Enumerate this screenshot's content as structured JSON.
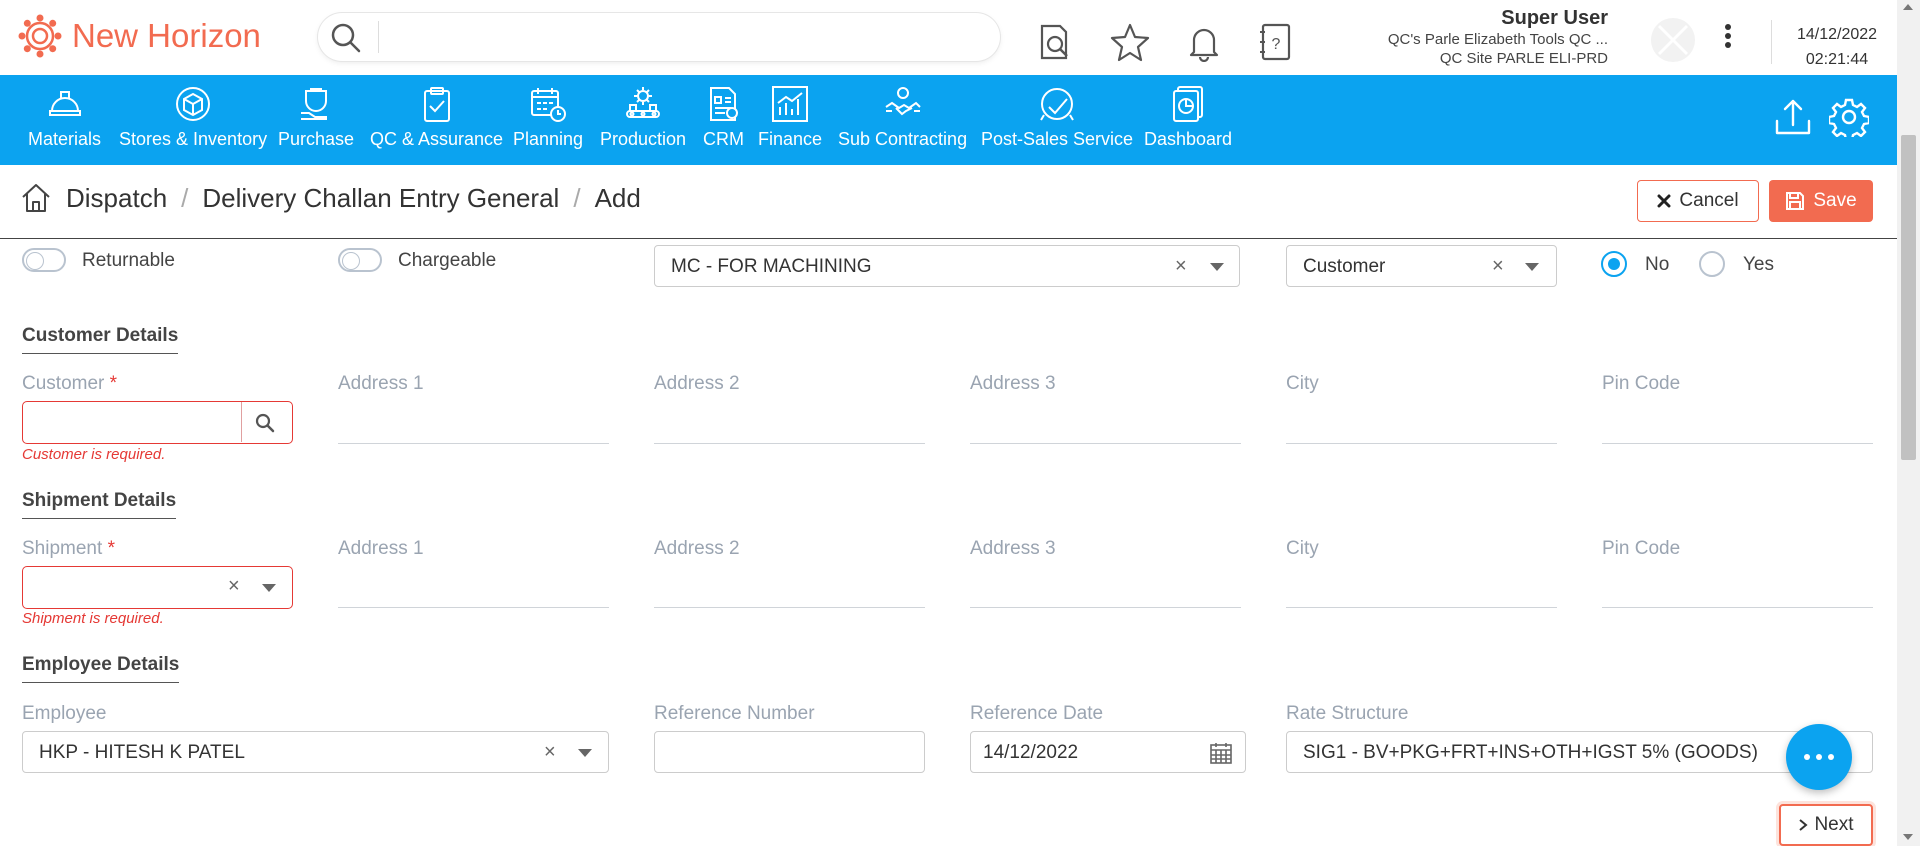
{
  "app": {
    "name": "New Horizon",
    "brand_color": "#f26b50",
    "nav_color": "#0ba3f0"
  },
  "search": {
    "placeholder": "",
    "value": ""
  },
  "topbar_icons": [
    "report-search-icon",
    "star-icon",
    "bell-icon",
    "help-book-icon"
  ],
  "user": {
    "name": "Super User",
    "company": "QC's Parle Elizabeth Tools QC ...",
    "site": "QC Site PARLE ELI-PRD"
  },
  "datetime": {
    "date": "14/12/2022",
    "time": "02:21:44"
  },
  "nav": {
    "items": [
      {
        "label": "Materials",
        "icon": "helmet-icon"
      },
      {
        "label": "Stores & Inventory",
        "icon": "box-icon"
      },
      {
        "label": "Purchase",
        "icon": "purchase-bag-icon"
      },
      {
        "label": "QC & Assurance",
        "icon": "clipboard-check-icon"
      },
      {
        "label": "Planning",
        "icon": "calendar-clock-icon"
      },
      {
        "label": "Production",
        "icon": "gear-conveyor-icon"
      },
      {
        "label": "CRM",
        "icon": "crm-doc-icon"
      },
      {
        "label": "Finance",
        "icon": "bar-chart-icon"
      },
      {
        "label": "Sub Contracting",
        "icon": "handshake-icon"
      },
      {
        "label": "Post-Sales Service",
        "icon": "service-icon"
      },
      {
        "label": "Dashboard",
        "icon": "dashboard-icon"
      }
    ]
  },
  "breadcrumb": {
    "items": [
      "Dispatch",
      "Delivery Challan Entry General",
      "Add"
    ]
  },
  "actions": {
    "cancel": "Cancel",
    "save": "Save",
    "next": "Next"
  },
  "top_row": {
    "returnable_label": "Returnable",
    "returnable_on": false,
    "chargeable_label": "Chargeable",
    "chargeable_on": false,
    "purpose_value": "MC - FOR MACHINING",
    "party_type_value": "Customer",
    "radio_no": "No",
    "radio_yes": "Yes",
    "radio_selected": "No"
  },
  "customer_section": {
    "title": "Customer Details",
    "customer_label": "Customer",
    "customer_value": "",
    "customer_error": "Customer is required.",
    "address1": "Address 1",
    "address2": "Address 2",
    "address3": "Address 3",
    "city": "City",
    "pin": "Pin Code"
  },
  "shipment_section": {
    "title": "Shipment Details",
    "shipment_label": "Shipment",
    "shipment_value": "",
    "shipment_error": "Shipment is required.",
    "address1": "Address 1",
    "address2": "Address 2",
    "address3": "Address 3",
    "city": "City",
    "pin": "Pin Code"
  },
  "employee_section": {
    "title": "Employee Details",
    "employee_label": "Employee",
    "employee_value": "HKP - HITESH K PATEL",
    "ref_number_label": "Reference Number",
    "ref_number_value": "",
    "ref_date_label": "Reference Date",
    "ref_date_value": "14/12/2022",
    "rate_structure_label": "Rate Structure",
    "rate_structure_value": "SIG1 - BV+PKG+FRT+INS+OTH+IGST 5% (GOODS)"
  },
  "required_mark": "*",
  "clear_glyph": "×"
}
